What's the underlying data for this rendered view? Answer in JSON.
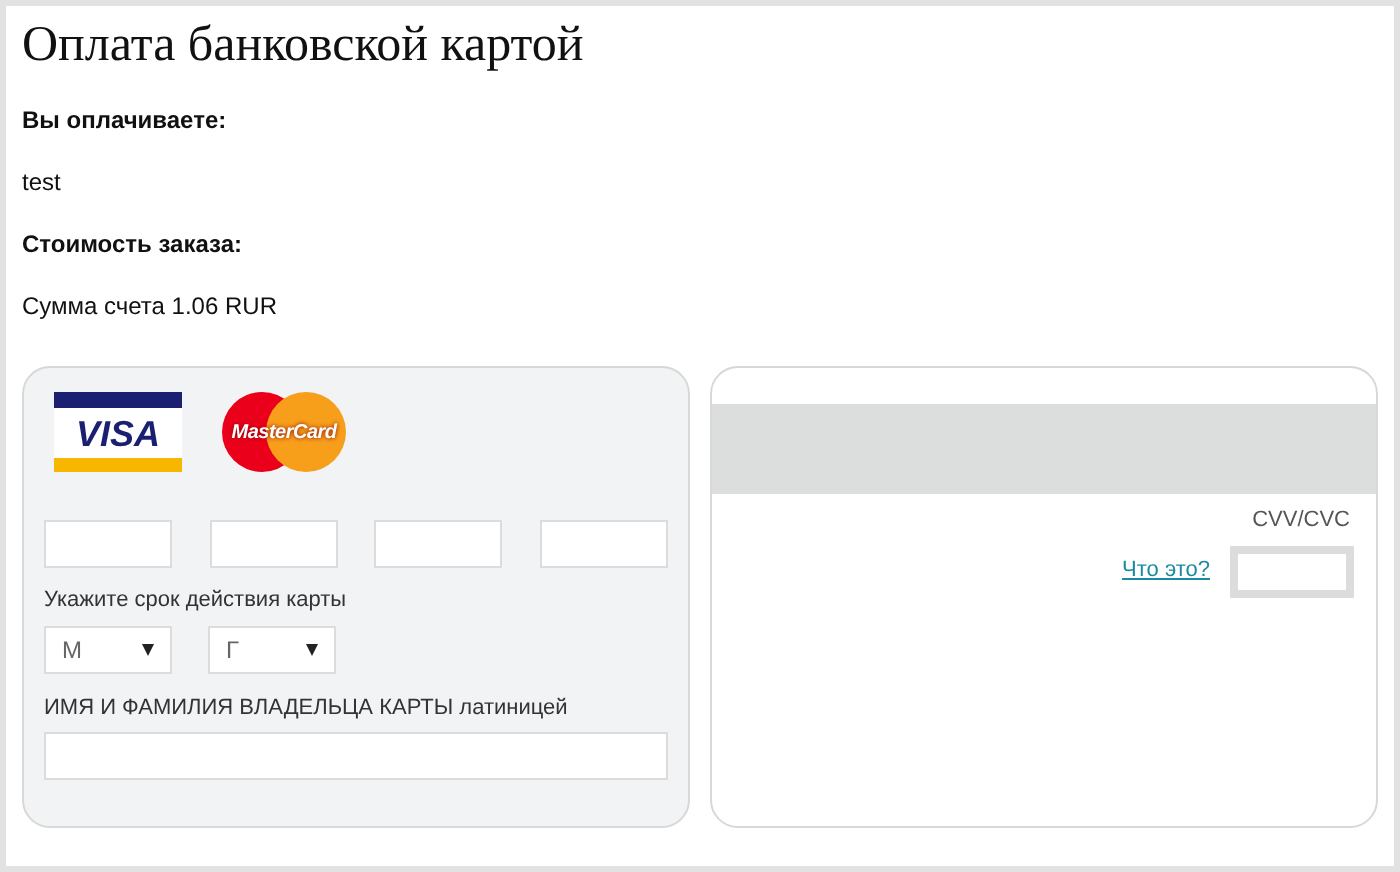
{
  "title": "Оплата банковской картой",
  "order": [
    {
      "kind": "label",
      "text": "Вы оплачиваете:"
    },
    {
      "kind": "value",
      "text": "test"
    },
    {
      "kind": "label",
      "text": "Стоимость заказа:"
    },
    {
      "kind": "value",
      "text": "Сумма счета 1.06 RUR"
    }
  ],
  "front": {
    "logos": [
      {
        "kind": "visa",
        "text": "VISA"
      },
      {
        "kind": "mastercard",
        "text": "MasterCard"
      }
    ],
    "expiry_label": "Укажите срок действия карты",
    "expiry": [
      {
        "value": "М"
      },
      {
        "value": "Г"
      }
    ],
    "name_label": "ИМЯ И ФАМИЛИЯ ВЛАДЕЛЬЦА КАРТЫ латиницей"
  },
  "back": {
    "cvv_label": "CVV/CVC",
    "help_link": "Что это?"
  }
}
